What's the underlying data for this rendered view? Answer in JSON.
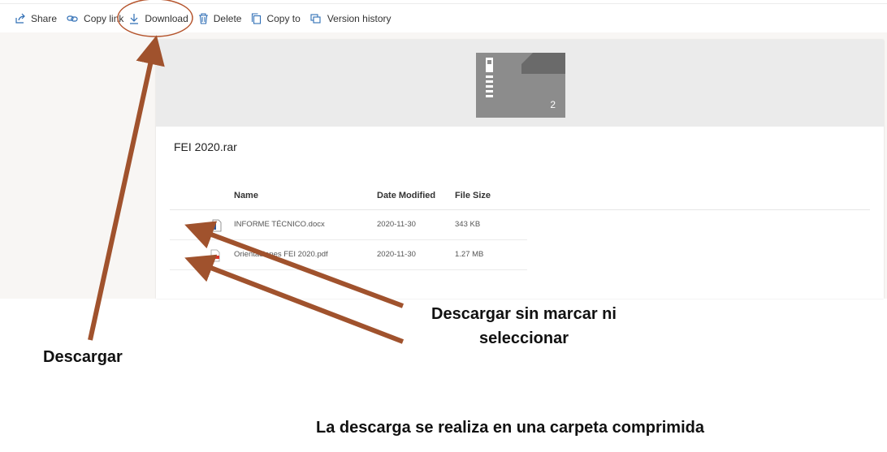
{
  "toolbar": {
    "share": "Share",
    "copy_link": "Copy link",
    "download": "Download",
    "delete": "Delete",
    "copy_to": "Copy to",
    "version_history": "Version history",
    "icons": [
      "share-icon",
      "link-icon",
      "download-icon",
      "trash-icon",
      "copy-icon",
      "version-history-icon"
    ]
  },
  "preview": {
    "item_count": "2",
    "icon": "zip-folder-icon"
  },
  "file": {
    "title": "FEI 2020.rar"
  },
  "table": {
    "headers": {
      "name": "Name",
      "date": "Date Modified",
      "size": "File Size"
    },
    "rows": [
      {
        "name": "INFORME TÉCNICO.docx",
        "date": "2020-11-30",
        "size": "343 KB",
        "icon": "word-doc-icon"
      },
      {
        "name": "Orientaciones FEI 2020.pdf",
        "date": "2020-11-30",
        "size": "1.27 MB",
        "icon": "pdf-icon"
      }
    ]
  },
  "annotations": {
    "descargar": "Descargar",
    "sin_marcar_line1": "Descargar sin marcar ni",
    "sin_marcar_line2": "seleccionar",
    "bottom_note": "La descarga se realiza en una carpeta comprimida",
    "arrow_color": "#a0522d",
    "circle_color": "#b5542c"
  }
}
